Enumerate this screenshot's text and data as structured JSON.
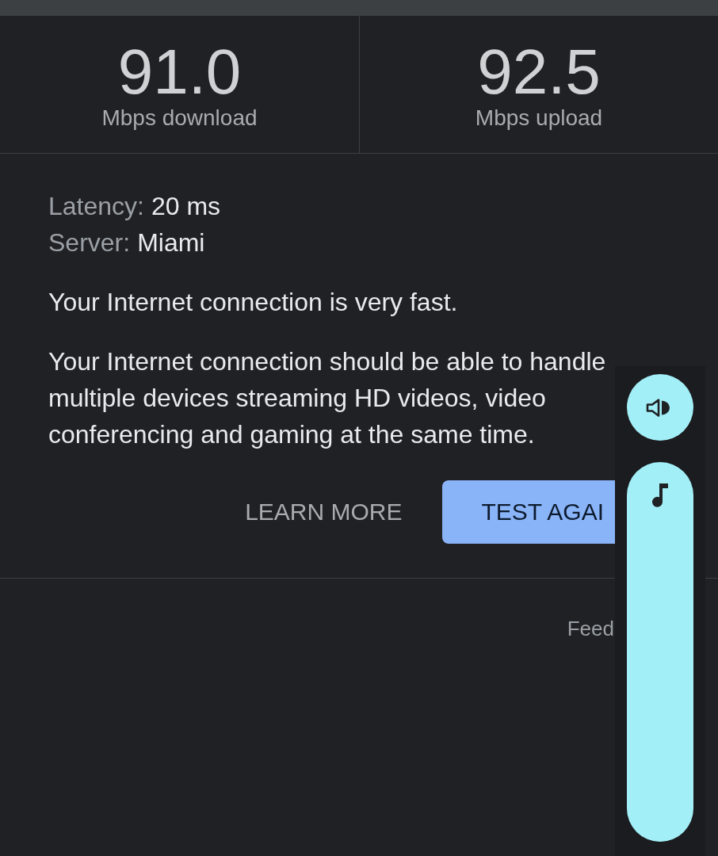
{
  "results": [
    {
      "value": "91.0",
      "unit": "Mbps download"
    },
    {
      "value": "92.5",
      "unit": "Mbps upload"
    }
  ],
  "details": [
    {
      "label": "Latency:",
      "value": "20 ms"
    },
    {
      "label": "Server:",
      "value": "Miami"
    }
  ],
  "summary": "Your Internet connection is very fast.",
  "description": "Your Internet connection should be able to handle multiple devices streaming HD videos, video conferencing and gaming at the same time.",
  "buttons": [
    {
      "label": "LEARN MORE",
      "kind": "text"
    },
    {
      "label": "TEST AGAI",
      "kind": "filled"
    }
  ],
  "footer": {
    "link": "Feed"
  },
  "volume_panel": {
    "slider": {
      "level": 1
    }
  }
}
